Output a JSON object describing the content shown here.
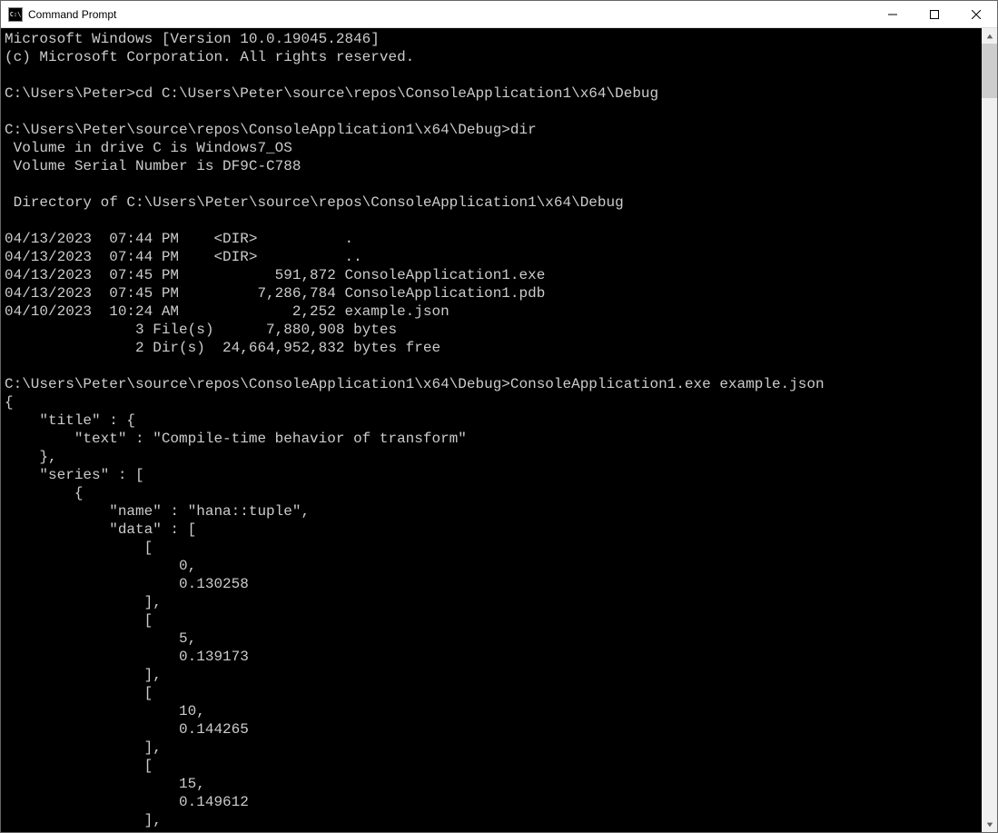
{
  "window": {
    "title": "Command Prompt",
    "icon_text": "C:\\"
  },
  "console": {
    "line1": "Microsoft Windows [Version 10.0.19045.2846]",
    "line2": "(c) Microsoft Corporation. All rights reserved.",
    "blank1": "",
    "prompt1": "C:\\Users\\Peter>cd C:\\Users\\Peter\\source\\repos\\ConsoleApplication1\\x64\\Debug",
    "blank2": "",
    "prompt2": "C:\\Users\\Peter\\source\\repos\\ConsoleApplication1\\x64\\Debug>dir",
    "vol1": " Volume in drive C is Windows7_OS",
    "vol2": " Volume Serial Number is DF9C-C788",
    "blank3": "",
    "dirof": " Directory of C:\\Users\\Peter\\source\\repos\\ConsoleApplication1\\x64\\Debug",
    "blank4": "",
    "d1": "04/13/2023  07:44 PM    <DIR>          .",
    "d2": "04/13/2023  07:44 PM    <DIR>          ..",
    "d3": "04/13/2023  07:45 PM           591,872 ConsoleApplication1.exe",
    "d4": "04/13/2023  07:45 PM         7,286,784 ConsoleApplication1.pdb",
    "d5": "04/10/2023  10:24 AM             2,252 example.json",
    "d6": "               3 File(s)      7,880,908 bytes",
    "d7": "               2 Dir(s)  24,664,952,832 bytes free",
    "blank5": "",
    "prompt3": "C:\\Users\\Peter\\source\\repos\\ConsoleApplication1\\x64\\Debug>ConsoleApplication1.exe example.json",
    "j1": "{",
    "j2": "    \"title\" : {",
    "j3": "        \"text\" : \"Compile-time behavior of transform\"",
    "j4": "    },",
    "j5": "    \"series\" : [",
    "j6": "        {",
    "j7": "            \"name\" : \"hana::tuple\",",
    "j8": "            \"data\" : [",
    "j9": "                [",
    "j10": "                    0,",
    "j11": "                    0.130258",
    "j12": "                ],",
    "j13": "                [",
    "j14": "                    5,",
    "j15": "                    0.139173",
    "j16": "                ],",
    "j17": "                [",
    "j18": "                    10,",
    "j19": "                    0.144265",
    "j20": "                ],",
    "j21": "                [",
    "j22": "                    15,",
    "j23": "                    0.149612",
    "j24": "                ],"
  }
}
